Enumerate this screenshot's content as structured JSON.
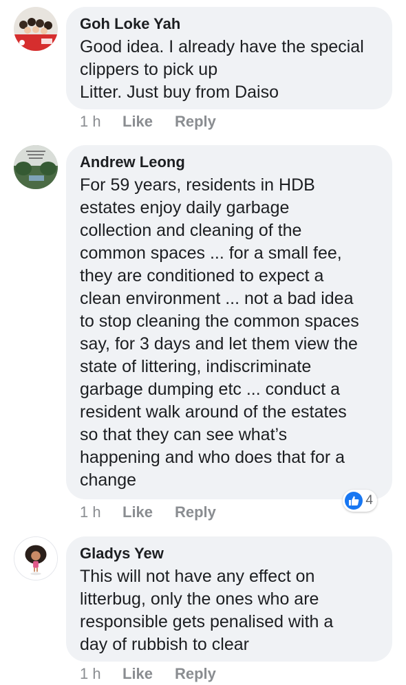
{
  "comments": [
    {
      "author": "Goh Loke Yah",
      "text": "Good idea. I already have the special\nclippers to pick up\nLitter. Just buy from Daiso",
      "time": "1 h",
      "like_label": "Like",
      "reply_label": "Reply",
      "avatar": "group-photo-avatar"
    },
    {
      "author": "Andrew Leong",
      "text": "For 59 years, residents in HDB\nestates enjoy daily garbage\ncollection and cleaning of the\ncommon spaces ... for a small fee,\nthey are conditioned to expect a\nclean environment ... not a bad idea\nto stop cleaning the common spaces\nsay, for 3 days and let them view the\nstate of littering, indiscriminate\ngarbage dumping etc ... conduct a\nresident walk around of the estates\nso that they can see what’s\nhappening and who does that for a\nchange",
      "time": "1 h",
      "like_label": "Like",
      "reply_label": "Reply",
      "reaction_count": "4",
      "avatar": "landscape-avatar"
    },
    {
      "author": "Gladys Yew",
      "text": "This will not have any effect on\nlitterbug, only the ones who are\nresponsible gets penalised with a\nday of rubbish to clear",
      "time": "1 h",
      "like_label": "Like",
      "reply_label": "Reply",
      "avatar": "cartoon-girl-avatar"
    }
  ],
  "colors": {
    "bubble": "#f0f2f5",
    "text": "#1c1e21",
    "meta": "#8a8d91",
    "like_blue": "#1877f2"
  }
}
